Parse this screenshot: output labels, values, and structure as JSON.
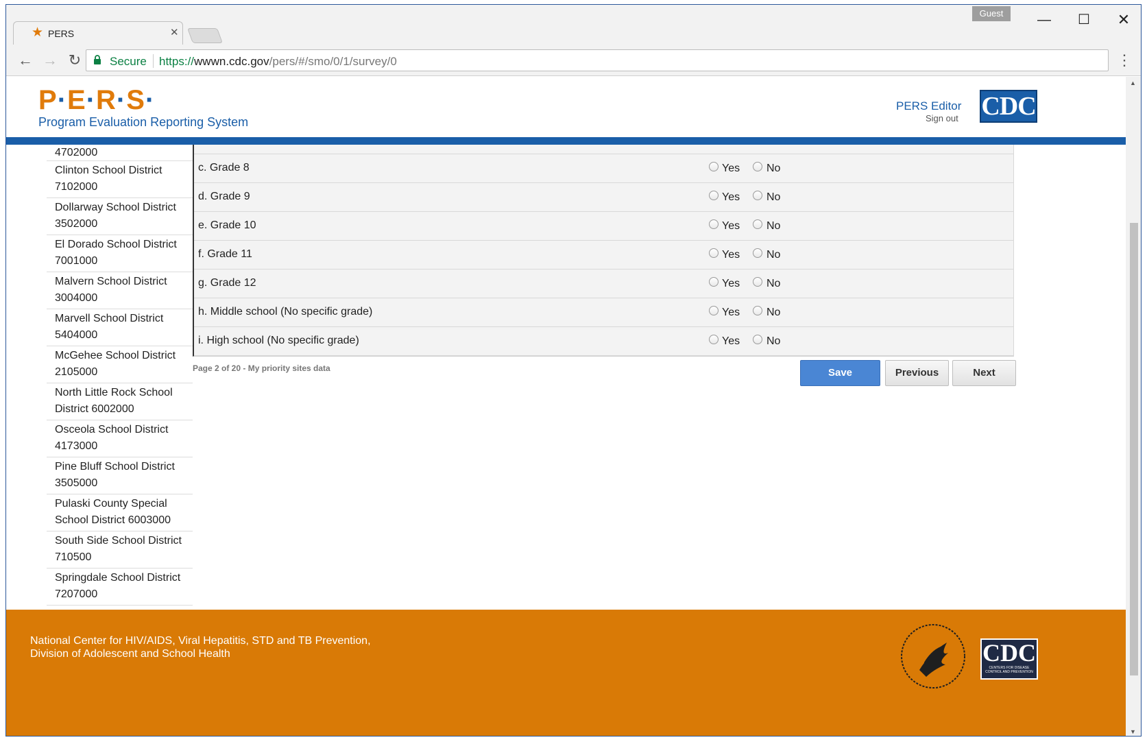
{
  "browser": {
    "tab_title": "PERS",
    "guest_label": "Guest",
    "secure_label": "Secure",
    "url_scheme": "https://",
    "url_host": "wwwn.cdc.gov",
    "url_path": "/pers/#/smo/0/1/survey/0"
  },
  "header": {
    "logo_letters": [
      "P",
      "E",
      "R",
      "S"
    ],
    "logo_subtitle": "Program Evaluation Reporting System",
    "editor_link": "PERS Editor",
    "signout_link": "Sign out",
    "cdc_logo_text": "CDC"
  },
  "sidebar": {
    "first_item_tail": "4702000",
    "items": [
      {
        "label": "Clinton School District 7102000"
      },
      {
        "label": "Dollarway School District 3502000"
      },
      {
        "label": "El Dorado School District 7001000"
      },
      {
        "label": "Malvern School District 3004000"
      },
      {
        "label": "Marvell School District 5404000"
      },
      {
        "label": "McGehee School District 2105000"
      },
      {
        "label": "North Little Rock School District 6002000"
      },
      {
        "label": "Osceola School District 4173000"
      },
      {
        "label": "Pine Bluff School District 3505000"
      },
      {
        "label": "Pulaski County Special School District 6003000"
      },
      {
        "label": "South Side School District 710500"
      },
      {
        "label": "Springdale School District 7207000"
      }
    ]
  },
  "questions": {
    "yes_label": "Yes",
    "no_label": "No",
    "rows": [
      {
        "label": "c. Grade 8"
      },
      {
        "label": "d. Grade 9"
      },
      {
        "label": "e. Grade 10"
      },
      {
        "label": "f. Grade 11"
      },
      {
        "label": "g. Grade 12"
      },
      {
        "label": "h. Middle school (No specific grade)"
      },
      {
        "label": "i. High school (No specific grade)"
      }
    ]
  },
  "pager": {
    "status": "Page 2 of 20 - My priority sites data",
    "save_label": "Save",
    "previous_label": "Previous",
    "next_label": "Next"
  },
  "footer": {
    "line1": "National Center for HIV/AIDS, Viral Hepatitis, STD and TB Prevention,",
    "line2": "Division of Adolescent and School Health",
    "cdc_logo_text": "CDC",
    "cdc_logo_small": "CENTERS FOR DISEASE CONTROL AND PREVENTION"
  },
  "colors": {
    "brand_orange": "#d97a06",
    "brand_blue": "#1a5ea8",
    "save_blue": "#4a86d4"
  }
}
